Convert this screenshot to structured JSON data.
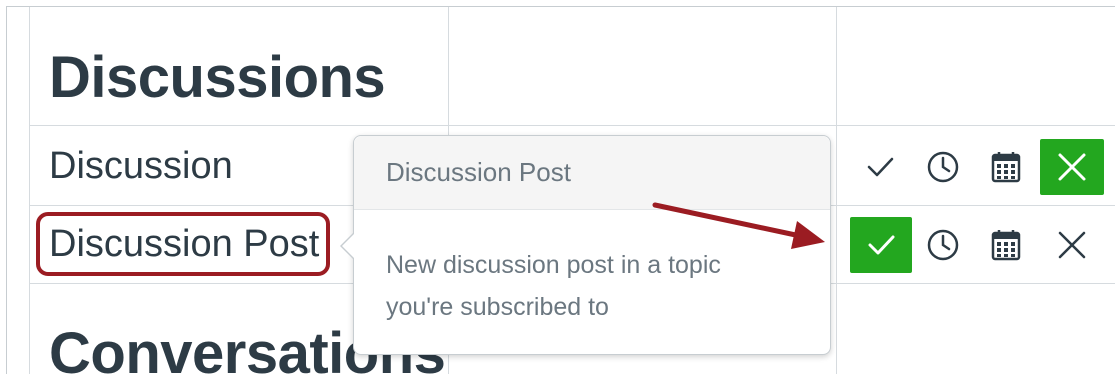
{
  "sections": {
    "discussions_title": "Discussions",
    "conversations_title": "Conversations"
  },
  "rows": [
    {
      "label": "Discussion",
      "selected": "never"
    },
    {
      "label": "Discussion Post",
      "selected": "immediately",
      "highlighted": true
    }
  ],
  "notification_options": [
    "immediately-check-icon",
    "daily-clock-icon",
    "weekly-calendar-icon",
    "never-x-icon"
  ],
  "popover": {
    "title": "Discussion Post",
    "description": "New discussion post in a topic you're subscribed to"
  },
  "colors": {
    "selected_green": "#23a71f",
    "highlight_red": "#9b1c22",
    "text_dark": "#2d3b45",
    "text_muted": "#6b7780"
  }
}
